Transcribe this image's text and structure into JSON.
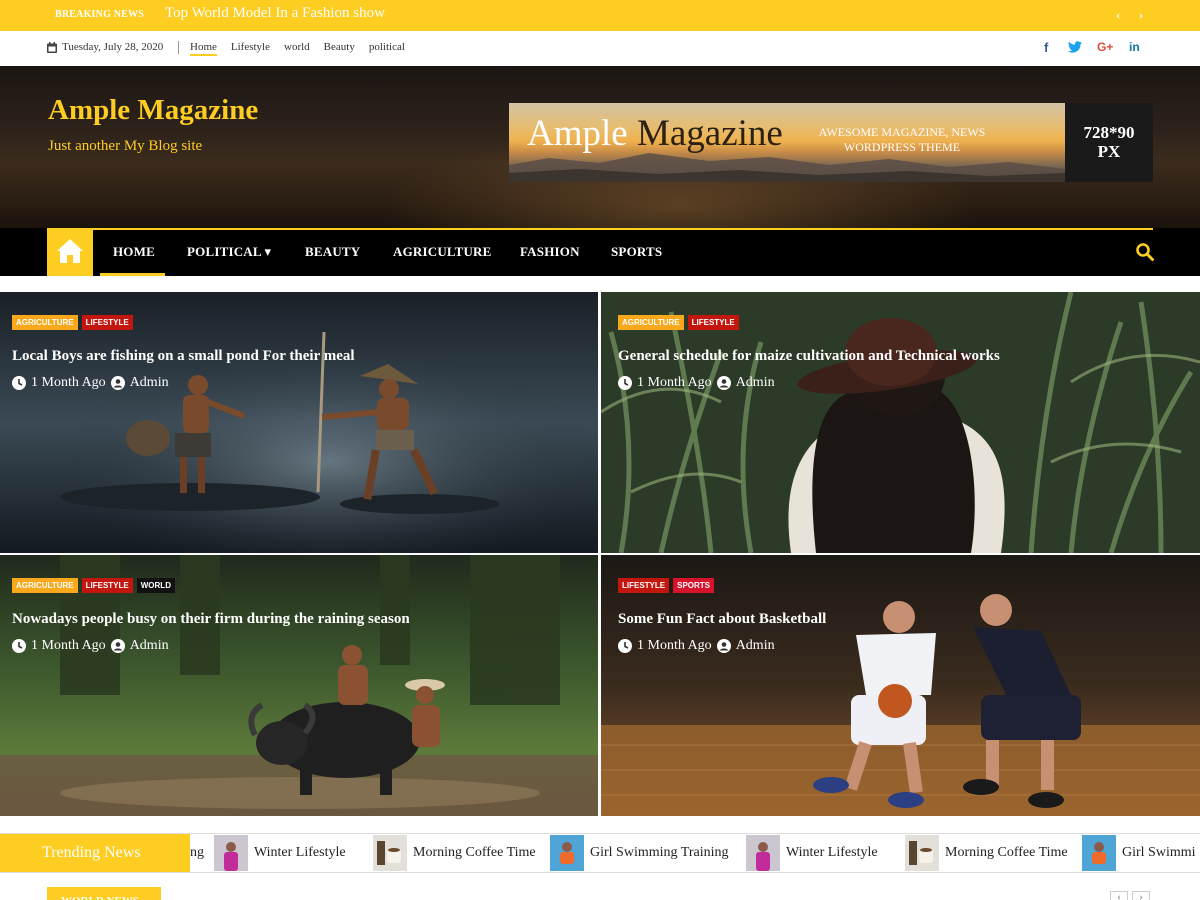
{
  "breaking": {
    "label": "BREAKING NEWS",
    "headline": "Top World Model In a Fashion show",
    "prev_icon": "chevron-left-icon",
    "next_icon": "chevron-right-icon"
  },
  "topbar": {
    "date": "Tuesday, July 28, 2020",
    "links": [
      "Home",
      "Lifestyle",
      "world",
      "Beauty",
      "political"
    ],
    "social": [
      "facebook-icon",
      "twitter-icon",
      "google-plus-icon",
      "linkedin-icon"
    ],
    "social_glyphs": [
      "f",
      "t",
      "G+",
      "in"
    ],
    "social_colors": [
      "#3b5998",
      "#1da1f2",
      "#dd4b39",
      "#0e76a8"
    ]
  },
  "header": {
    "site_title": "Ample Magazine",
    "tagline": "Just another My Blog site",
    "ad": {
      "title_light": "Ample ",
      "title_dark": "Magazine",
      "subtitle_line1": "AWESOME MAGAZINE, NEWS",
      "subtitle_line2": "WORDPRESS THEME",
      "size_line1": "728*90",
      "size_line2": "PX"
    }
  },
  "nav": {
    "items": [
      "HOME",
      "POLITICAL",
      "BEAUTY",
      "AGRICULTURE",
      "FASHION",
      "SPORTS"
    ],
    "dropdown_marker": "▾",
    "accent": "#fdcd22"
  },
  "posts": [
    {
      "cats": [
        "AGRICULTURE",
        "LIFESTYLE"
      ],
      "title": "Local Boys are fishing on a small pond For their meal",
      "time": "1 Month Ago",
      "author": "Admin"
    },
    {
      "cats": [
        "AGRICULTURE",
        "LIFESTYLE"
      ],
      "title": "General schedule for maize cultivation and Technical works",
      "time": "1 Month Ago",
      "author": "Admin"
    },
    {
      "cats": [
        "AGRICULTURE",
        "LIFESTYLE",
        "WORLD"
      ],
      "title": "Nowadays people busy on their firm during the raining season",
      "time": "1 Month Ago",
      "author": "Admin"
    },
    {
      "cats": [
        "LIFESTYLE",
        "SPORTS"
      ],
      "title": "Some Fun Fact about Basketball",
      "time": "1 Month Ago",
      "author": "Admin"
    }
  ],
  "trending": {
    "label": "Trending News",
    "items": [
      "ng",
      "Winter Lifestyle",
      "Morning Coffee Time",
      "Girl Swimming Training",
      "Winter Lifestyle",
      "Morning Coffee Time",
      "Girl Swimmi"
    ]
  },
  "world_news": {
    "label": "WORLD NEWS",
    "prev": "‹",
    "next": "›"
  }
}
